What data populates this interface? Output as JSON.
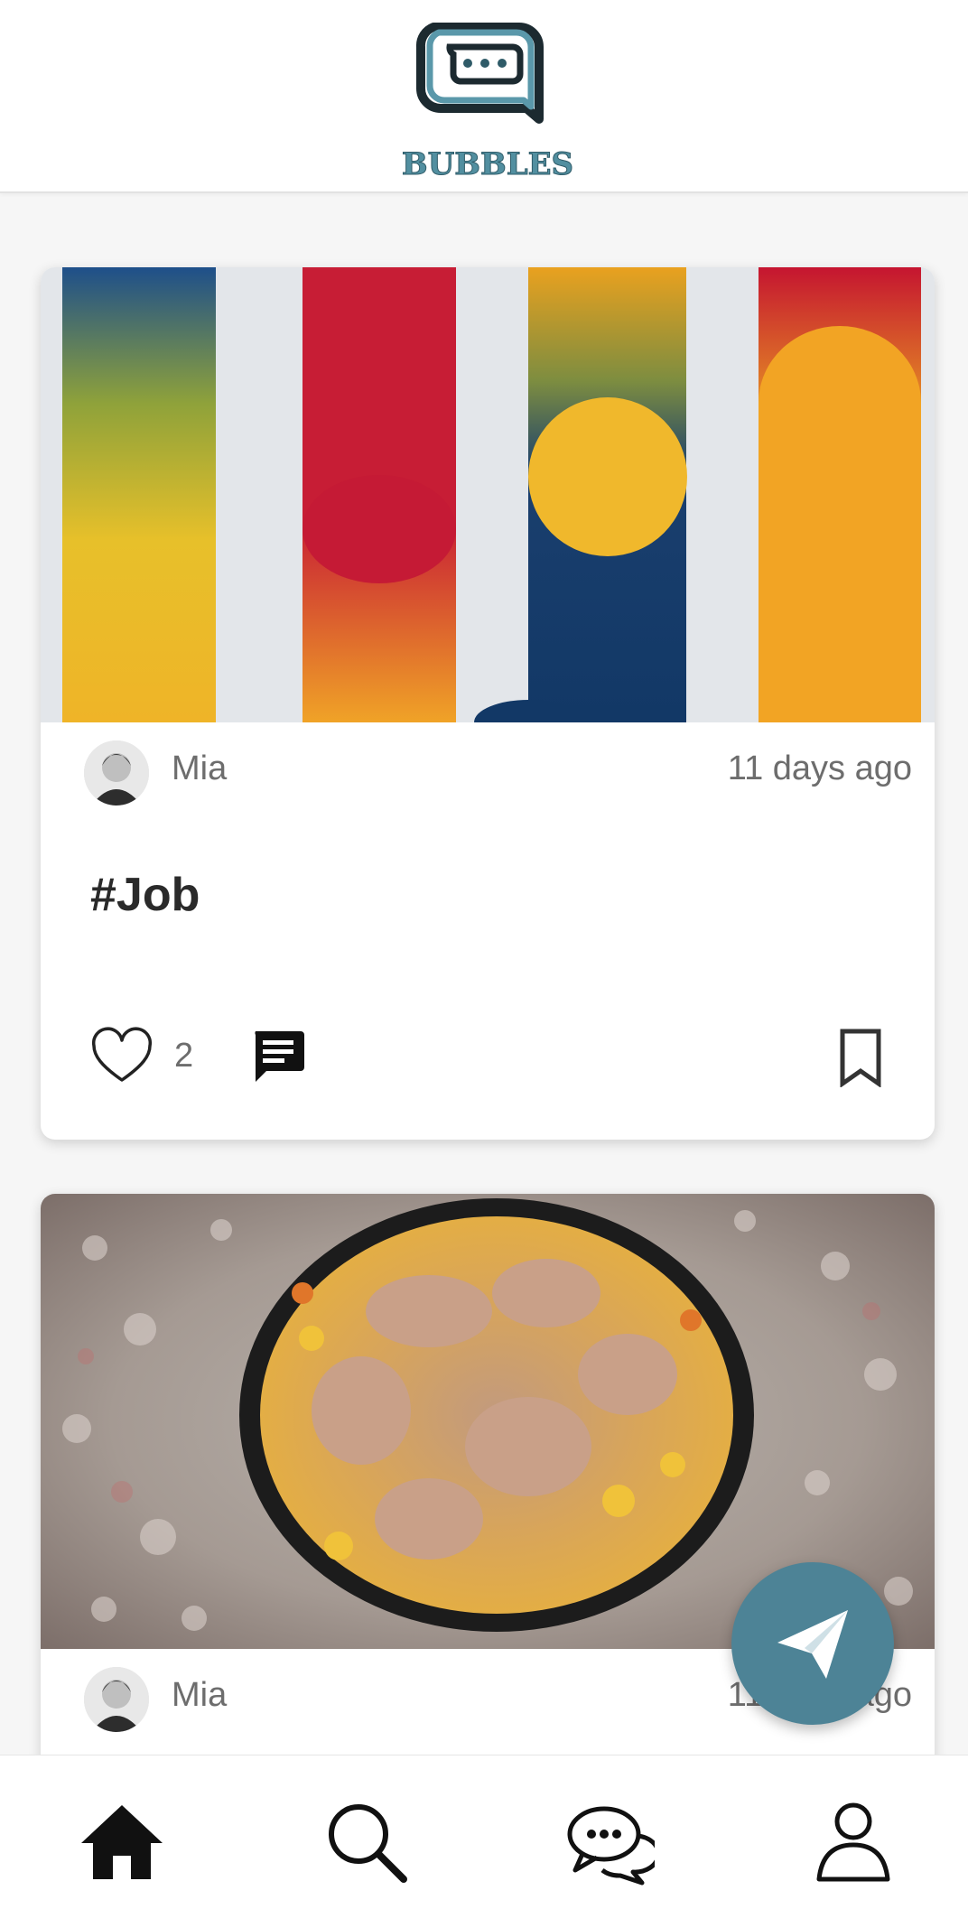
{
  "header": {
    "logo_text": "BUBBLES",
    "brand_color": "#528fa0"
  },
  "feed": {
    "posts": [
      {
        "author": "Mia",
        "time": "11 days ago",
        "caption": "#Job",
        "like_count": "2",
        "image_icon": "abstract-art-image"
      },
      {
        "author": "Mia",
        "time": "11 days ago",
        "image_icon": "roast-chicken-pan-image"
      }
    ]
  },
  "fab": {
    "icon": "send-icon",
    "color": "#4d8396"
  },
  "bottom_nav": {
    "items": [
      {
        "icon": "home-icon"
      },
      {
        "icon": "search-icon"
      },
      {
        "icon": "chat-bubbles-icon"
      },
      {
        "icon": "profile-icon"
      }
    ]
  }
}
